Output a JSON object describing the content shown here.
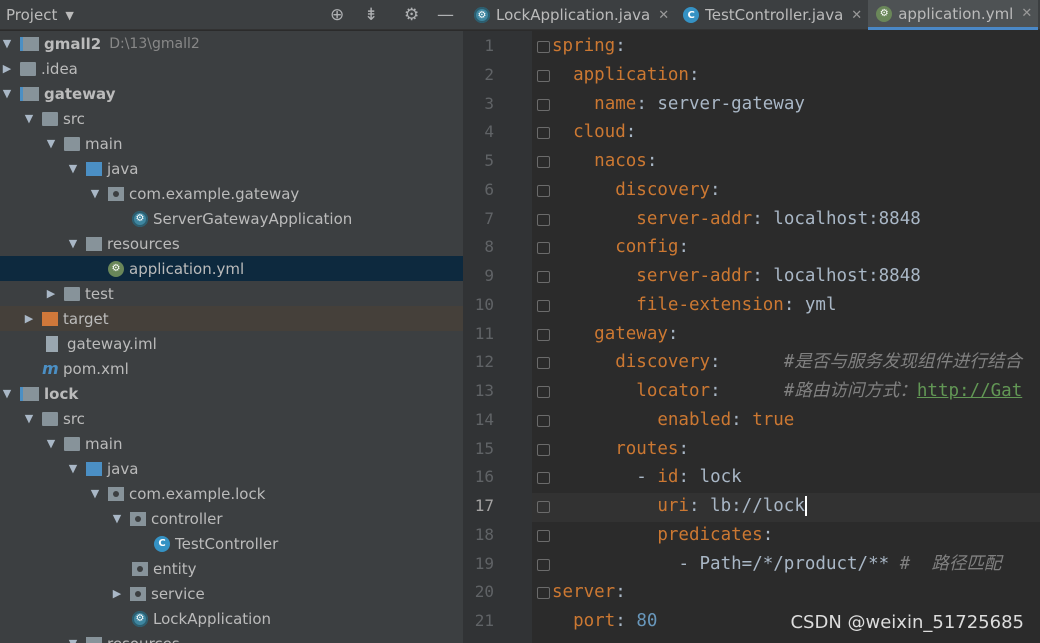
{
  "project_panel": {
    "title": "Project"
  },
  "tabs": [
    {
      "label": "LockApplication.java",
      "icon": "spring-app-icon"
    },
    {
      "label": "TestController.java",
      "icon": "java-class-icon"
    },
    {
      "label": "application.yml",
      "icon": "yaml-spring-icon",
      "active": true
    }
  ],
  "tree": [
    {
      "label": "gmall2",
      "extra": "D:\\13\\gmall2"
    },
    {
      "label": ".idea"
    },
    {
      "label": "gateway"
    },
    {
      "label": "src"
    },
    {
      "label": "main"
    },
    {
      "label": "java"
    },
    {
      "label": "com.example.gateway"
    },
    {
      "label": "ServerGatewayApplication"
    },
    {
      "label": "resources"
    },
    {
      "label": "application.yml"
    },
    {
      "label": "test"
    },
    {
      "label": "target"
    },
    {
      "label": "gateway.iml"
    },
    {
      "label": "pom.xml"
    },
    {
      "label": "lock"
    },
    {
      "label": "src"
    },
    {
      "label": "main"
    },
    {
      "label": "java"
    },
    {
      "label": "com.example.lock"
    },
    {
      "label": "controller"
    },
    {
      "label": "TestController"
    },
    {
      "label": "entity"
    },
    {
      "label": "service"
    },
    {
      "label": "LockApplication"
    },
    {
      "label": "resources"
    }
  ],
  "editor": {
    "line_numbers": [
      "1",
      "2",
      "3",
      "4",
      "5",
      "6",
      "7",
      "8",
      "9",
      "10",
      "11",
      "12",
      "13",
      "14",
      "15",
      "16",
      "17",
      "18",
      "19",
      "20",
      "21"
    ],
    "current_line": "17",
    "lines": [
      {
        "k": "spring",
        "sep": ":"
      },
      {
        "k": "application",
        "sep": ":"
      },
      {
        "k": "name",
        "sep": ": ",
        "v": "server-gateway"
      },
      {
        "k": "cloud",
        "sep": ":"
      },
      {
        "k": "nacos",
        "sep": ":"
      },
      {
        "k": "discovery",
        "sep": ":"
      },
      {
        "k": "server-addr",
        "sep": ": ",
        "v": "localhost:8848"
      },
      {
        "k": "config",
        "sep": ":"
      },
      {
        "k": "server-addr",
        "sep": ": ",
        "v": "localhost:8848"
      },
      {
        "k": "file-extension",
        "sep": ": ",
        "v": "yml"
      },
      {
        "k": "gateway",
        "sep": ":"
      },
      {
        "k": "discovery",
        "sep": ":",
        "pad": "      ",
        "c": "#是否与服务发现组件进行结合"
      },
      {
        "k": "locator",
        "sep": ":",
        "pad": "      ",
        "c": "#路由访问方式：",
        "link": "http://Gat"
      },
      {
        "k": "enabled",
        "sep": ": ",
        "kwv": "true"
      },
      {
        "k": "routes",
        "sep": ":"
      },
      {
        "dash": "- ",
        "k": "id",
        "sep": ": ",
        "v": "lock"
      },
      {
        "k": "uri",
        "sep": ": ",
        "v": "lb://lock"
      },
      {
        "k": "predicates",
        "sep": ":"
      },
      {
        "dash": "- ",
        "v": "Path=/*/product/**",
        "c": " #  路径匹配"
      },
      {
        "k": "server",
        "sep": ":"
      },
      {
        "k": "port",
        "sep": ": ",
        "n": "80"
      }
    ]
  },
  "watermark": "CSDN @weixin_51725685"
}
